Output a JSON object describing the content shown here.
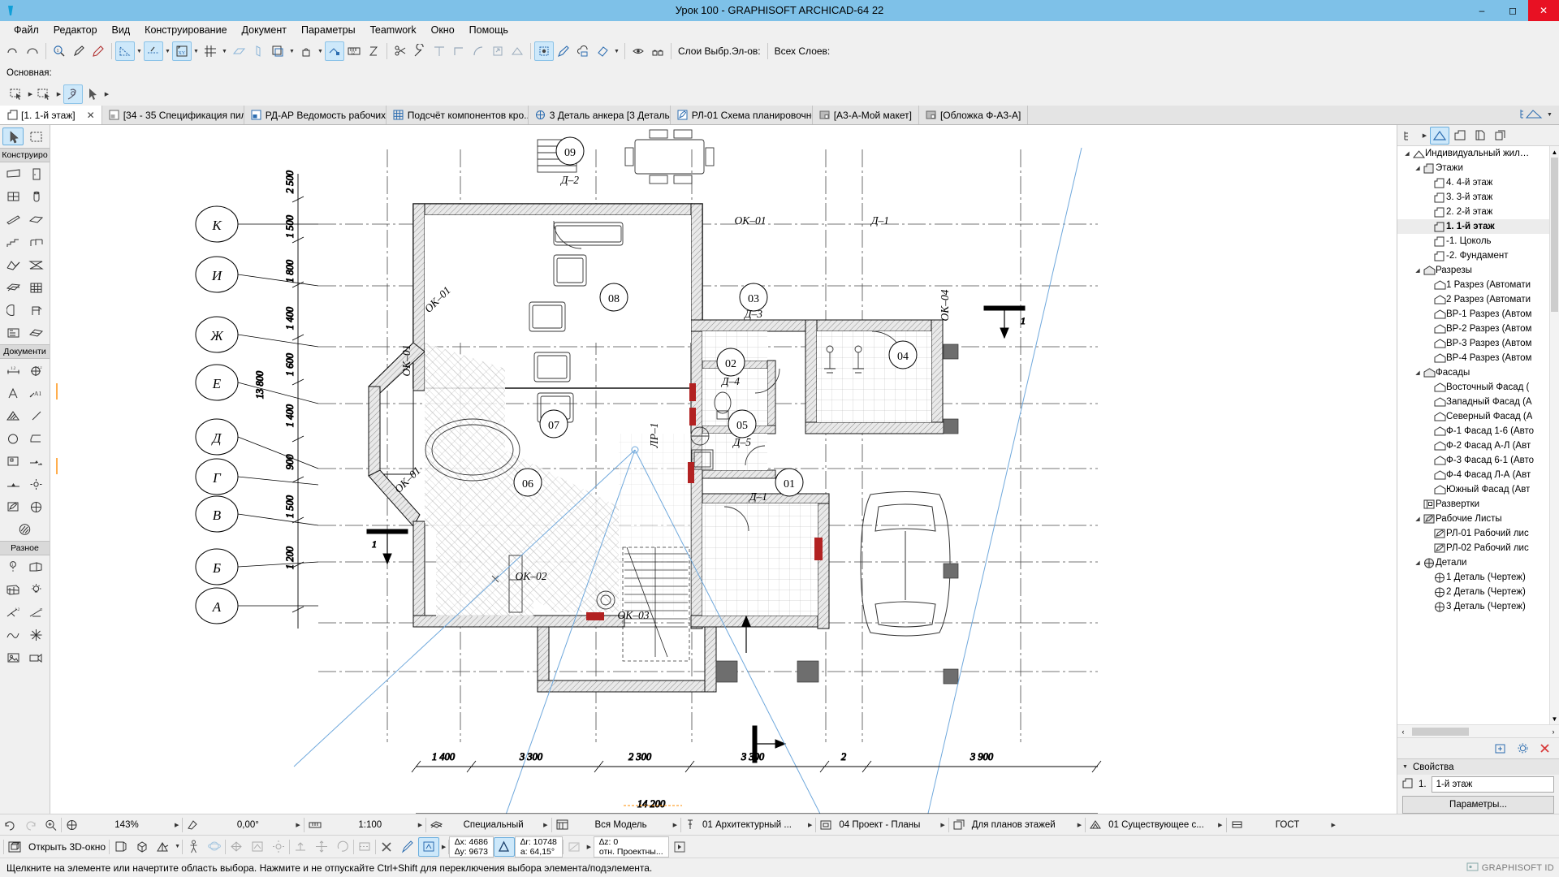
{
  "window": {
    "title": "Урок 100 - GRAPHISOFT ARCHICAD-64 22",
    "minimize": "‒",
    "maximize": "◻",
    "close": "✕"
  },
  "menu": [
    "Файл",
    "Редактор",
    "Вид",
    "Конструирование",
    "Документ",
    "Параметры",
    "Teamwork",
    "Окно",
    "Помощь"
  ],
  "toolbar": {
    "layers_selected_label": "Слои Выбр.Эл-ов:",
    "all_layers_label": "Всех Слоев:",
    "info_label": "Основная:"
  },
  "tabs": [
    {
      "label": "[1. 1-й этаж]",
      "icon": "storey-icon",
      "active": true,
      "closable": true
    },
    {
      "label": "[34 - 35 Спецификация пил...",
      "icon": "schedule-icon",
      "active": false
    },
    {
      "label": "РД-АР Ведомость рабочих ...",
      "icon": "worksheet-icon",
      "active": false
    },
    {
      "label": "Подсчёт компонентов кро...",
      "icon": "grid-icon",
      "active": false
    },
    {
      "label": "3 Деталь анкера [3 Деталь]",
      "icon": "detail-icon",
      "active": false
    },
    {
      "label": "РЛ-01 Схема планировочно...",
      "icon": "worksheet-icon",
      "active": false
    },
    {
      "label": "[А3-А-Мой макет]",
      "icon": "layout-icon",
      "active": false
    },
    {
      "label": "[Обложка Ф-А3-А]",
      "icon": "layout-icon",
      "active": false
    }
  ],
  "tool_palette": {
    "sections": [
      {
        "title": "",
        "items": [
          "arrow-select-icon",
          "marquee-icon"
        ]
      },
      {
        "title": "Конструирование",
        "items": [
          "wall-icon",
          "door-icon",
          "window-icon",
          "column-icon",
          "beam-icon",
          "slab-icon",
          "stair-icon",
          "railing-icon",
          "roof-icon",
          "shell-icon",
          "mesh-icon",
          "curtain-wall-icon",
          "morph-icon",
          "object-icon",
          "zone-icon",
          "skylight-icon"
        ]
      },
      {
        "title": "Документирование",
        "items": [
          "dimension-icon",
          "radial-dimension-icon",
          "text-icon",
          "label-icon",
          "fill-icon",
          "line-icon",
          "circle-icon",
          "polyline-icon",
          "figure-icon",
          "level-dimension-icon",
          "elevation-icon",
          "hotspot-icon",
          "worksheet-icon",
          "detail-icon",
          "paint-icon"
        ]
      },
      {
        "title": "Разное",
        "items": [
          "section-marker-icon",
          "interior-elev-icon",
          "grid-element-icon",
          "lamp-icon",
          "angle-dim-icon",
          "angle-icon",
          "spline-icon",
          "hotlink-icon",
          "image-icon",
          "camera-icon"
        ]
      }
    ]
  },
  "navigator": {
    "tree": [
      {
        "level": 0,
        "label": "Индивидуальный жил…",
        "icon": "project-icon",
        "expanded": true
      },
      {
        "level": 1,
        "label": "Этажи",
        "icon": "storeys-folder-icon",
        "expanded": true
      },
      {
        "level": 2,
        "label": "4. 4-й этаж",
        "icon": "storey-icon"
      },
      {
        "level": 2,
        "label": "3. 3-й этаж",
        "icon": "storey-icon"
      },
      {
        "level": 2,
        "label": "2. 2-й этаж",
        "icon": "storey-icon"
      },
      {
        "level": 2,
        "label": "1. 1-й этаж",
        "icon": "storey-icon",
        "selected": true
      },
      {
        "level": 2,
        "label": "-1. Цоколь",
        "icon": "storey-icon"
      },
      {
        "level": 2,
        "label": "-2. Фундамент",
        "icon": "storey-icon"
      },
      {
        "level": 1,
        "label": "Разрезы",
        "icon": "sections-folder-icon",
        "expanded": true
      },
      {
        "level": 2,
        "label": "1 Разрез (Автомати",
        "icon": "section-icon"
      },
      {
        "level": 2,
        "label": "2 Разрез (Автомати",
        "icon": "section-icon"
      },
      {
        "level": 2,
        "label": "ВР-1 Разрез (Автом",
        "icon": "section-icon"
      },
      {
        "level": 2,
        "label": "ВР-2 Разрез (Автом",
        "icon": "section-icon"
      },
      {
        "level": 2,
        "label": "ВР-3 Разрез (Автом",
        "icon": "section-icon"
      },
      {
        "level": 2,
        "label": "ВР-4 Разрез (Автом",
        "icon": "section-icon"
      },
      {
        "level": 1,
        "label": "Фасады",
        "icon": "elevations-folder-icon",
        "expanded": true
      },
      {
        "level": 2,
        "label": "Восточный Фасад (",
        "icon": "elevation-icon"
      },
      {
        "level": 2,
        "label": "Западный Фасад (А",
        "icon": "elevation-icon"
      },
      {
        "level": 2,
        "label": "Северный Фасад (А",
        "icon": "elevation-icon"
      },
      {
        "level": 2,
        "label": "Ф-1 Фасад 1-6 (Авто",
        "icon": "elevation-icon"
      },
      {
        "level": 2,
        "label": "Ф-2 Фасад А-Л (Авт",
        "icon": "elevation-icon"
      },
      {
        "level": 2,
        "label": "Ф-3 Фасад 6-1 (Авто",
        "icon": "elevation-icon"
      },
      {
        "level": 2,
        "label": "Ф-4 Фасад Л-А (Авт",
        "icon": "elevation-icon"
      },
      {
        "level": 2,
        "label": "Южный Фасад (Авт",
        "icon": "elevation-icon"
      },
      {
        "level": 1,
        "label": "Развертки",
        "icon": "interior-elev-icon"
      },
      {
        "level": 1,
        "label": "Рабочие Листы",
        "icon": "worksheets-folder-icon",
        "expanded": true
      },
      {
        "level": 2,
        "label": "РЛ-01 Рабочий лис",
        "icon": "worksheet-icon"
      },
      {
        "level": 2,
        "label": "РЛ-02 Рабочий лис",
        "icon": "worksheet-icon"
      },
      {
        "level": 1,
        "label": "Детали",
        "icon": "details-folder-icon",
        "expanded": true
      },
      {
        "level": 2,
        "label": "1 Деталь (Чертеж)",
        "icon": "detail-icon"
      },
      {
        "level": 2,
        "label": "2 Деталь (Чертеж)",
        "icon": "detail-icon"
      },
      {
        "level": 2,
        "label": "3 Деталь (Чертеж)",
        "icon": "detail-icon"
      }
    ],
    "properties_title": "Свойства",
    "properties_number": "1.",
    "properties_value": "1-й этаж",
    "properties_button": "Параметры..."
  },
  "statusbar": {
    "zoom": "143%",
    "orientation": "0,00°",
    "scale": "1:100",
    "pen_set": "Специальный",
    "model_view": "Вся Модель",
    "layer_combo": "01 Архитектурный ...",
    "structure": "04 Проект - Планы",
    "partial_structure": "Для планов этажей",
    "renovation": "01 Существующее с...",
    "dimension_standard": "ГОСТ"
  },
  "bottombar": {
    "open_3d_label": "Открыть 3D-окно",
    "coords": {
      "dx_label": "∆x:",
      "dx": "4686",
      "dy_label": "∆y:",
      "dy": "9673",
      "dr_label": "∆r:",
      "dr": "10748",
      "da_label": "a:",
      "da": "64,15°",
      "dz_label": "∆z:",
      "dz": "0",
      "rel_label": "отн. Проектны..."
    }
  },
  "message": "Щелкните на элементе или начертите область выбора. Нажмите и не отпускайте Ctrl+Shift для переключения выбора элемента/подэлемента.",
  "brand": "GRAPHISOFT ID",
  "floorplan": {
    "grid_labels_vertical": [
      "К",
      "И",
      "Ж",
      "Е",
      "Д",
      "Г",
      "В",
      "Б",
      "А"
    ],
    "vertical_dims": [
      "2 500",
      "1 500",
      "1 800",
      "1 400",
      "1 600",
      "1 400",
      "900",
      "1 500",
      "1 200"
    ],
    "vertical_total": "13 800",
    "horizontal_dims": [
      "1 400",
      "3 300",
      "2 300",
      "3 300",
      "2",
      "3 900"
    ],
    "horizontal_total": "14 200",
    "room_numbers": [
      "09",
      "08",
      "03",
      "04",
      "02",
      "07",
      "05",
      "06",
      "01"
    ],
    "door_labels": [
      "Д-2",
      "Д-1",
      "Д-3",
      "Д-4",
      "Д-5",
      "Д-1"
    ],
    "window_labels": [
      "ОК-01",
      "ОК-01",
      "ОК-01",
      "ОК-01",
      "ОК-04",
      "ОК-02",
      "ОК-03"
    ],
    "stair_label": "ЛР-1",
    "section_marker": "1"
  }
}
